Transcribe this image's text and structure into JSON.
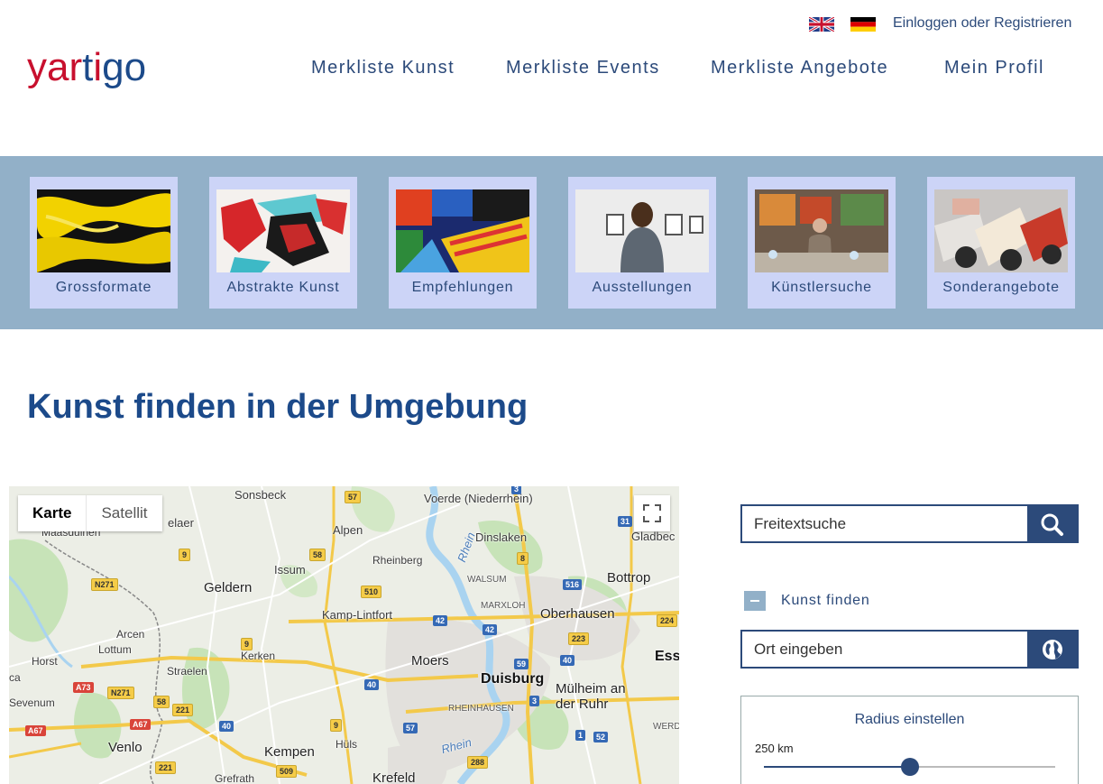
{
  "header": {
    "logo": {
      "part1": "yar",
      "part2": "t",
      "part3": "i",
      "part4": "go"
    },
    "login_label": "Einloggen oder Registrieren",
    "nav": [
      "Merkliste Kunst",
      "Merkliste Events",
      "Merkliste Angebote",
      "Mein Profil"
    ]
  },
  "categories": [
    "Grossformate",
    "Abstrakte Kunst",
    "Empfehlungen",
    "Ausstellungen",
    "Künstlersuche",
    "Sonderangebote"
  ],
  "heading": "Kunst finden in der Umgebung",
  "map": {
    "type_map": "Karte",
    "type_satellite": "Satellit",
    "places": [
      "Sonsbeck",
      "Voerde (Niederrhein)",
      "Gladbec",
      "elaer",
      "Alpen",
      "Dinslaken",
      "Maasduinen",
      "Issum",
      "Rheinberg",
      "Bottrop",
      "Geldern",
      "WALSUM",
      "MARXLOH",
      "Oberhausen",
      "Kamp-Lintfort",
      "Arcen",
      "Lottum",
      "Kerken",
      "Moers",
      "Duisburg",
      "Ess",
      "Horst",
      "Straelen",
      "Mülheim an der Ruhr",
      "Sevenum",
      "RHEINHAUSEN",
      "WERDE",
      "Venlo",
      "Hüls",
      "Kempen",
      "Grefrath",
      "Krefeld",
      "Rhein",
      "Rhein",
      "ca"
    ],
    "roads": [
      "57",
      "3",
      "31",
      "9",
      "58",
      "8",
      "516",
      "N271",
      "510",
      "42",
      "42",
      "224",
      "9",
      "223",
      "40",
      "59",
      "A73",
      "N271",
      "40",
      "3",
      "58",
      "221",
      "A67",
      "40",
      "9",
      "57",
      "1",
      "52",
      "A67",
      "221",
      "509",
      "288"
    ]
  },
  "sidebar": {
    "search_placeholder": "Freitextsuche",
    "section_label": "Kunst finden",
    "location_placeholder": "Ort eingeben",
    "radius_title": "Radius einstellen",
    "radius_value": "250 km",
    "radius_fraction": 0.5
  },
  "colors": {
    "primary": "#2c4a7a",
    "heading": "#1c4a8a",
    "band": "#92b0c8",
    "tile": "#ccd4f7",
    "logo_red": "#c8102e"
  }
}
